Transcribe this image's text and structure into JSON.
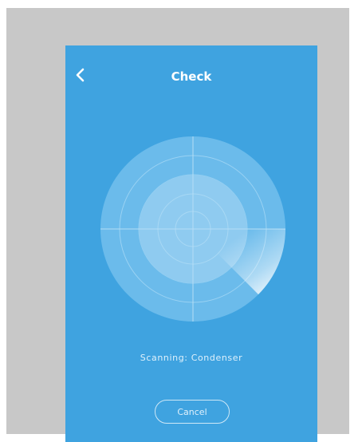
{
  "header": {
    "title": "Check",
    "back_icon": "chevron-left-icon"
  },
  "scan": {
    "status_text": "Scanning: Condenser"
  },
  "actions": {
    "cancel_label": "Cancel"
  },
  "colors": {
    "background": "#3fa3e0",
    "page_backdrop": "#c8c8c8",
    "radar_outer": "#6bbbeb",
    "radar_inner": "#8fcbf0",
    "text": "#ffffff"
  }
}
